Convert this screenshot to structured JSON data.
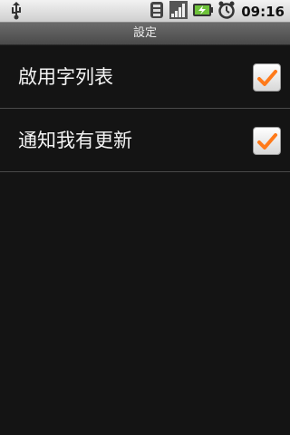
{
  "status_bar": {
    "time": "09:16",
    "icons": [
      "usb-icon",
      "sync-icon",
      "signal-icon",
      "battery-charging-icon",
      "alarm-icon"
    ]
  },
  "title_bar": {
    "title": "設定"
  },
  "settings": {
    "items": [
      {
        "label": "啟用字列表",
        "checked": true
      },
      {
        "label": "通知我有更新",
        "checked": true
      }
    ]
  },
  "colors": {
    "accent": "#ff7a1a",
    "background": "#141414"
  }
}
